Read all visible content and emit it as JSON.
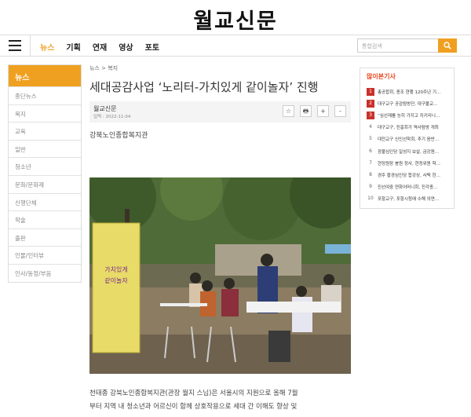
{
  "header": {
    "logo": "월교신문"
  },
  "nav": {
    "items": [
      {
        "label": "뉴스",
        "active": true
      },
      {
        "label": "기획",
        "active": false
      },
      {
        "label": "연재",
        "active": false
      },
      {
        "label": "영상",
        "active": false
      },
      {
        "label": "포토",
        "active": false
      }
    ],
    "search_placeholder": "통합검색",
    "accent_color": "#f0a020"
  },
  "sidebar": {
    "title": "뉴스",
    "items": [
      "종단뉴스",
      "복지",
      "교육",
      "일반",
      "청소년",
      "문화/문화재",
      "신행단체",
      "학술",
      "출판",
      "인물/인터뷰",
      "인사/동정/부음"
    ]
  },
  "article": {
    "breadcrumb": "뉴스 > 복지",
    "title": "세대공감사업 ‘노리터-가치있게 같이놀자’ 진행",
    "author": "월교신문",
    "date": "입력 : 2022-11-04",
    "tools": [
      "☆",
      "🖶",
      "+",
      "-"
    ],
    "subtitle": "강북노인종합복지관",
    "banner_text": "가치있게 같이놀자",
    "body_line1": "천태종 강북노인종합복지관(관장 월지 스님)은 서울시의 지원으로 올해 7월",
    "body_line2": "부터 지역 내 청소년과 어르신이 함께 상호작용으로 세대 간 이해도 향상 및"
  },
  "popular": {
    "title": "많이본기사",
    "items": [
      {
        "rank": "1",
        "text": "총공합회, 종조 현행 120주년 기…",
        "hot": true
      },
      {
        "rank": "2",
        "text": "대구교구 공감탐방단, 대구불교…",
        "hot": true
      },
      {
        "rank": "3",
        "text": "“심선재를 능히 가지고 지키리니…",
        "hot": true
      },
      {
        "rank": "4",
        "text": "대구교구, 진흥회가 역사탐방 개최",
        "hot": false
      },
      {
        "rank": "5",
        "text": "대전교구 신인선학회, 추기 음반…",
        "hot": false
      },
      {
        "rank": "6",
        "text": "광불심인당 일성지 보살, 금강원…",
        "hot": false
      },
      {
        "rank": "7",
        "text": "현정원장 봉원 정사, 현정위원 학…",
        "hot": false
      },
      {
        "rank": "8",
        "text": "경주 황경심인당 합강상, 사택 헌…",
        "hot": false
      },
      {
        "rank": "9",
        "text": "진선여중 연화어머니회, 진각종…",
        "hot": false
      },
      {
        "rank": "10",
        "text": "포항교구, 포항시청에 수해 의연…",
        "hot": false
      }
    ]
  }
}
